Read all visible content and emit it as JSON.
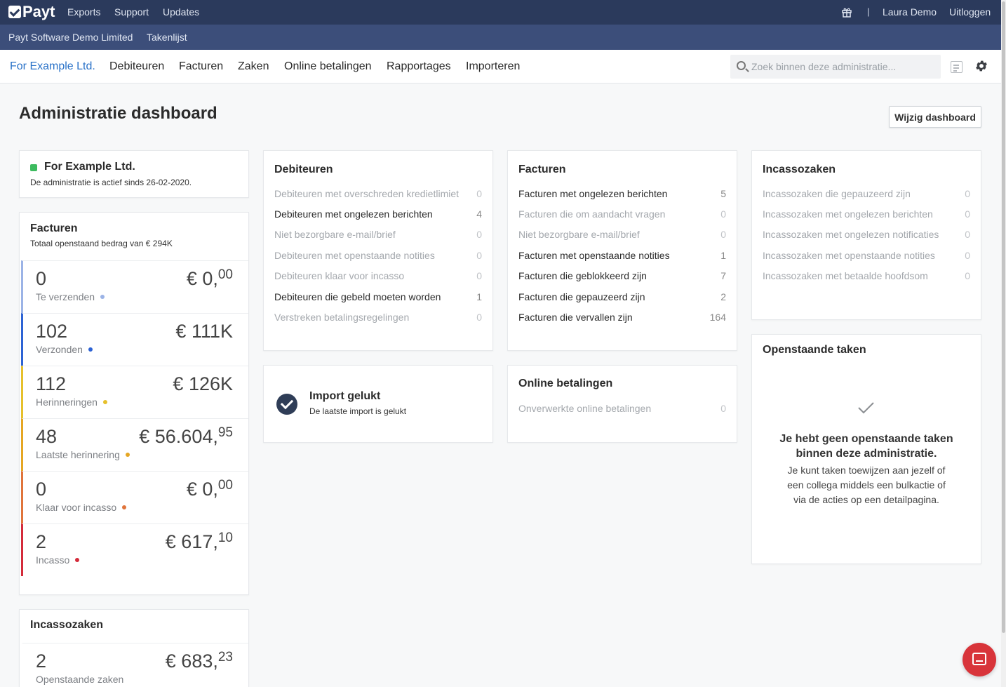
{
  "topbar": {
    "brand": "Payt",
    "links": [
      "Exports",
      "Support",
      "Updates"
    ],
    "user": "Laura Demo",
    "logout": "Uitloggen",
    "separator": "|"
  },
  "subbar": {
    "company": "Payt Software Demo Limited",
    "tasks": "Takenlijst"
  },
  "nav": {
    "items": [
      "For Example Ltd.",
      "Debiteuren",
      "Facturen",
      "Zaken",
      "Online betalingen",
      "Rapportages",
      "Importeren"
    ],
    "search_placeholder": "Zoek binnen deze administratie..."
  },
  "page": {
    "title": "Administratie dashboard",
    "edit_button": "Wijzig dashboard"
  },
  "admin_card": {
    "name": "For Example Ltd.",
    "status_text": "De administratie is actief sinds 26-02-2020.",
    "status_color": "#3dbb5f"
  },
  "invoices_card": {
    "title": "Facturen",
    "subtitle": "Totaal openstaand bedrag van € 294K",
    "stats": [
      {
        "count": "0",
        "label": "Te verzenden",
        "amount": "€ 0,",
        "cents": "00",
        "color": "#9bb3e6"
      },
      {
        "count": "102",
        "label": "Verzonden",
        "amount": "€ 111K",
        "cents": "",
        "color": "#2d63d4"
      },
      {
        "count": "112",
        "label": "Herinneringen",
        "amount": "€ 126K",
        "cents": "",
        "color": "#e6c02b"
      },
      {
        "count": "48",
        "label": "Laatste herinnering",
        "amount": "€ 56.604,",
        "cents": "95",
        "color": "#e5a623"
      },
      {
        "count": "0",
        "label": "Klaar voor incasso",
        "amount": "€ 0,",
        "cents": "00",
        "color": "#e0743b"
      },
      {
        "count": "2",
        "label": "Incasso",
        "amount": "€ 617,",
        "cents": "10",
        "color": "#d42b3a"
      }
    ]
  },
  "collections_card": {
    "title": "Incassozaken",
    "count": "2",
    "label": "Openstaande zaken",
    "amount": "€ 683,",
    "cents": "23"
  },
  "debtors_card": {
    "title": "Debiteuren",
    "rows": [
      {
        "label": "Debiteuren met overschreden kredietlimiet",
        "value": "0",
        "active": false
      },
      {
        "label": "Debiteuren met ongelezen berichten",
        "value": "4",
        "active": true
      },
      {
        "label": "Niet bezorgbare e-mail/brief",
        "value": "0",
        "active": false
      },
      {
        "label": "Debiteuren met openstaande notities",
        "value": "0",
        "active": false
      },
      {
        "label": "Debiteuren klaar voor incasso",
        "value": "0",
        "active": false
      },
      {
        "label": "Debiteuren die gebeld moeten worden",
        "value": "1",
        "active": true
      },
      {
        "label": "Verstreken betalingsregelingen",
        "value": "0",
        "active": false
      }
    ]
  },
  "facturen_card": {
    "title": "Facturen",
    "rows": [
      {
        "label": "Facturen met ongelezen berichten",
        "value": "5",
        "active": true
      },
      {
        "label": "Facturen die om aandacht vragen",
        "value": "0",
        "active": false
      },
      {
        "label": "Niet bezorgbare e-mail/brief",
        "value": "0",
        "active": false
      },
      {
        "label": "Facturen met openstaande notities",
        "value": "1",
        "active": true
      },
      {
        "label": "Facturen die geblokkeerd zijn",
        "value": "7",
        "active": true
      },
      {
        "label": "Facturen die gepauzeerd zijn",
        "value": "2",
        "active": true
      },
      {
        "label": "Facturen die vervallen zijn",
        "value": "164",
        "active": true
      }
    ]
  },
  "incasso_card": {
    "title": "Incassozaken",
    "rows": [
      {
        "label": "Incassozaken die gepauzeerd zijn",
        "value": "0",
        "active": false
      },
      {
        "label": "Incassozaken met ongelezen berichten",
        "value": "0",
        "active": false
      },
      {
        "label": "Incassozaken met ongelezen notificaties",
        "value": "0",
        "active": false
      },
      {
        "label": "Incassozaken met openstaande notities",
        "value": "0",
        "active": false
      },
      {
        "label": "Incassozaken met betaalde hoofdsom",
        "value": "0",
        "active": false
      }
    ]
  },
  "import_card": {
    "title": "Import gelukt",
    "subtitle": "De laatste import is gelukt"
  },
  "online_card": {
    "title": "Online betalingen",
    "rows": [
      {
        "label": "Onverwerkte online betalingen",
        "value": "0",
        "active": false
      }
    ]
  },
  "tasks_card": {
    "title": "Openstaande taken",
    "empty_title": "Je hebt geen openstaande taken binnen deze administratie.",
    "empty_desc": "Je kunt taken toewijzen aan jezelf of een collega middels een bulkactie of via de acties op een detailpagina."
  }
}
